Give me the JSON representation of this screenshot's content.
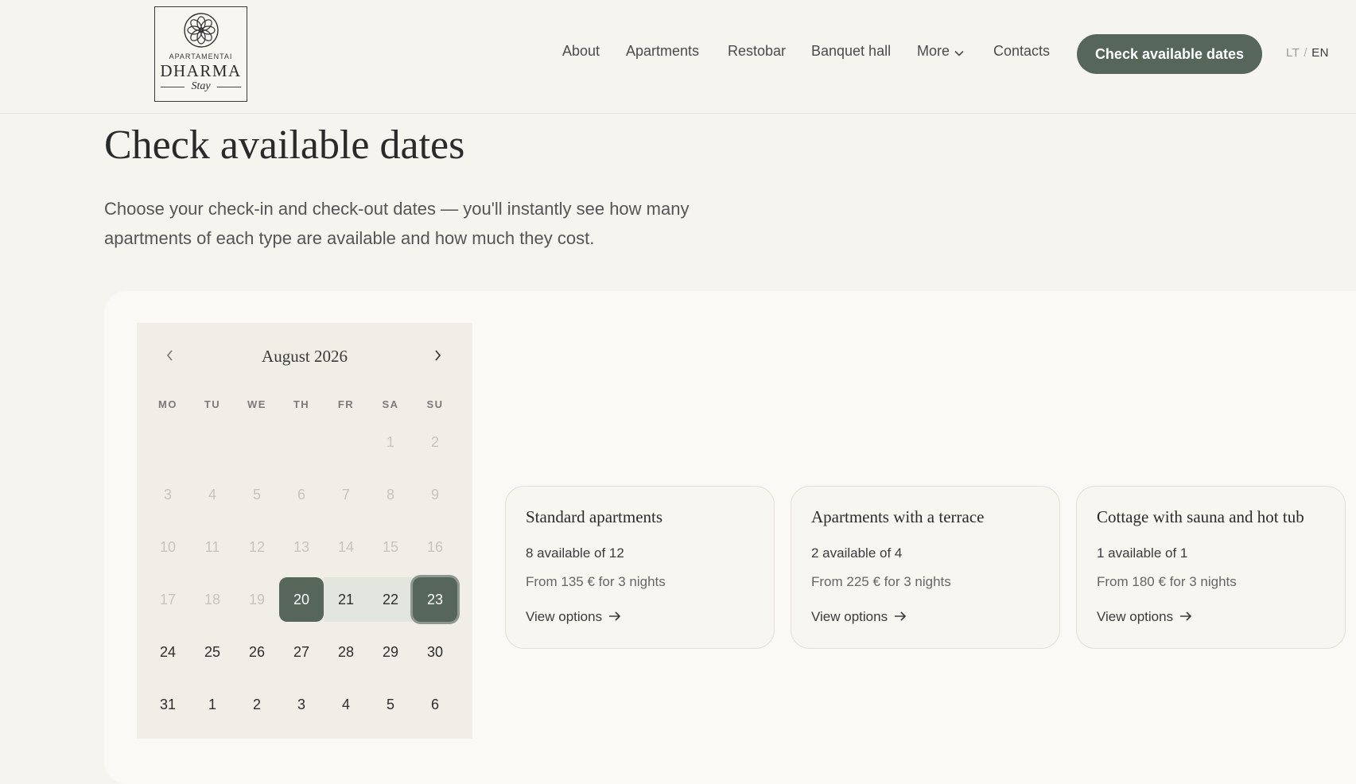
{
  "logo": {
    "top_text": "APARTAMENTAI",
    "main_text": "DHARMA",
    "script_text": "Stay"
  },
  "nav": {
    "items": [
      "About",
      "Apartments",
      "Restobar",
      "Banquet hall",
      "More",
      "Contacts"
    ],
    "cta": "Check available dates",
    "lang": {
      "lt": "LT",
      "separator": "/",
      "en": "EN",
      "active": "EN"
    }
  },
  "page": {
    "title": "Check available dates",
    "intro": "Choose your check-in and check-out dates — you'll instantly see how many apartments of each type are available and how much they cost."
  },
  "calendar": {
    "month_label": "August 2026",
    "weekdays": [
      "MO",
      "TU",
      "WE",
      "TH",
      "FR",
      "SA",
      "SU"
    ],
    "weeks": [
      [
        "",
        "",
        "",
        "",
        "",
        "1",
        "2"
      ],
      [
        "3",
        "4",
        "5",
        "6",
        "7",
        "8",
        "9"
      ],
      [
        "10",
        "11",
        "12",
        "13",
        "14",
        "15",
        "16"
      ],
      [
        "17",
        "18",
        "19",
        "20",
        "21",
        "22",
        "23"
      ],
      [
        "24",
        "25",
        "26",
        "27",
        "28",
        "29",
        "30"
      ],
      [
        "31",
        "1",
        "2",
        "3",
        "4",
        "5",
        "6"
      ]
    ],
    "check_in": "20",
    "check_out": "23",
    "in_range": [
      "21",
      "22"
    ],
    "past_days_until": "19"
  },
  "cards": [
    {
      "title": "Standard apartments",
      "availability": "8 available of 12",
      "price": "From 135 € for 3 nights",
      "link": "View options"
    },
    {
      "title": "Apartments with a terrace",
      "availability": "2 available of 4",
      "price": "From 225 € for 3 nights",
      "link": "View options"
    },
    {
      "title": "Cottage with sauna and hot tub",
      "availability": "1 available of 1",
      "price": "From 180 € for 3 nights",
      "link": "View options"
    }
  ],
  "colors": {
    "accent": "#56665a",
    "background": "#f6f4ef",
    "range": "#e2e6de"
  },
  "icons": {
    "prev": "chevron-left-icon",
    "next": "chevron-right-icon",
    "more": "chevron-down-icon",
    "link": "arrow-right-icon"
  }
}
